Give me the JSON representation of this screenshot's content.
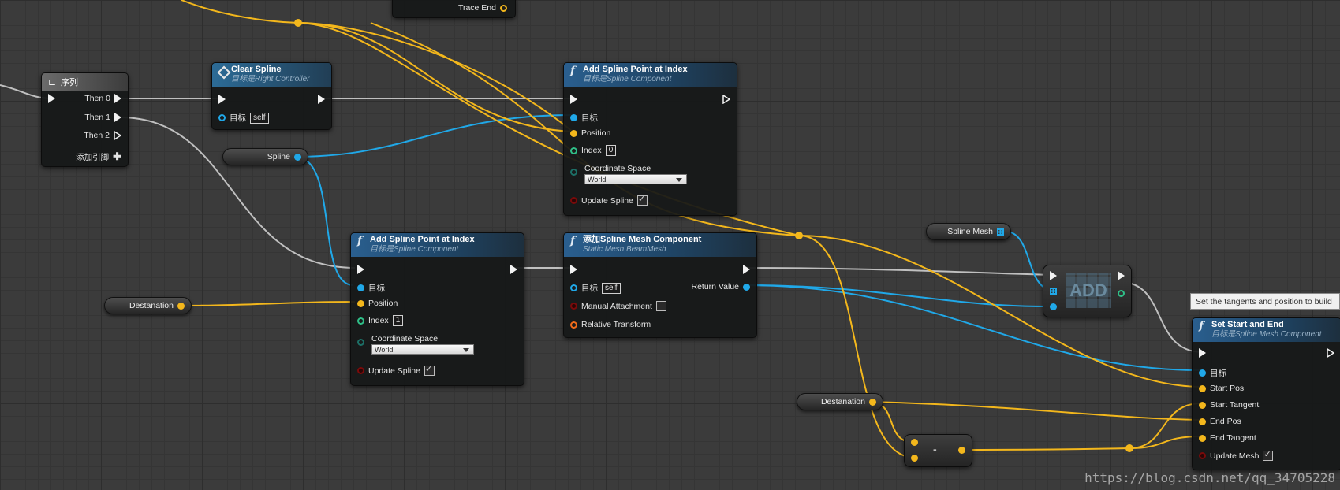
{
  "nodes": {
    "trace": {
      "label": "Trace End"
    },
    "sequence": {
      "title": "序列",
      "then0": "Then 0",
      "then1": "Then 1",
      "then2": "Then 2",
      "add_pin": "添加引脚"
    },
    "clear_spline": {
      "title": "Clear Spline",
      "subtitle": "目标是Right Controller",
      "target_label": "目标",
      "target_value": "self"
    },
    "add_point_1": {
      "title": "Add Spline Point at Index",
      "subtitle": "目标是Spline Component",
      "target": "目标",
      "position": "Position",
      "index_label": "Index",
      "index_value": "0",
      "coord_label": "Coordinate Space",
      "coord_value": "World",
      "update_label": "Update Spline",
      "update_checked": true
    },
    "add_point_2": {
      "title": "Add Spline Point at Index",
      "subtitle": "目标是Spline Component",
      "target": "目标",
      "position": "Position",
      "index_label": "Index",
      "index_value": "1",
      "coord_label": "Coordinate Space",
      "coord_value": "World",
      "update_label": "Update Spline",
      "update_checked": true
    },
    "add_mesh": {
      "title": "添加Spline Mesh Component",
      "subtitle": "Static Mesh BeamMesh",
      "target": "目标",
      "target_value": "self",
      "manual": "Manual Attachment",
      "relative": "Relative Transform",
      "return": "Return Value"
    },
    "add_array": {
      "label": "ADD"
    },
    "set_start_end": {
      "title": "Set Start and End",
      "subtitle": "目标是Spline Mesh Component",
      "target": "目标",
      "start_pos": "Start Pos",
      "start_tangent": "Start Tangent",
      "end_pos": "End Pos",
      "end_tangent": "End Tangent",
      "update_mesh": "Update Mesh"
    },
    "subtract": {
      "label": "-"
    }
  },
  "variables": {
    "spline": "Spline",
    "spline_mesh": "Spline Mesh",
    "destanation_1": "Destanation",
    "destanation_2": "Destanation"
  },
  "tooltip": "Set the tangents and position to build",
  "watermark": "https://blog.csdn.net/qq_34705228",
  "colors": {
    "exec": "#f2f2f2",
    "object": "#20a8e8",
    "vector": "#f3b71c",
    "int": "#2fbf88",
    "bool": "#7a0a0a",
    "transform": "#f06b1a"
  }
}
